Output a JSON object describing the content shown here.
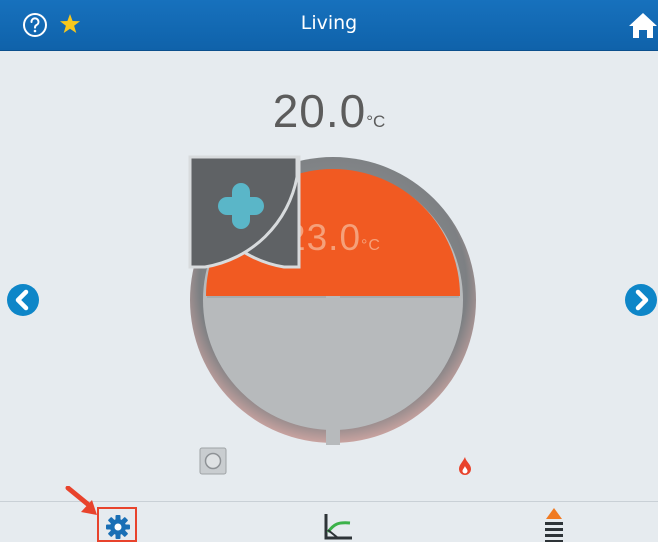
{
  "header": {
    "title": "Living",
    "icons": {
      "help": "help-icon",
      "favorite": "star-icon",
      "home": "home-icon"
    }
  },
  "current_temperature": {
    "value": "20.0",
    "unit": "°C"
  },
  "setpoint": {
    "value": "23.0",
    "unit": "°C"
  },
  "controls": {
    "decrease": "minus-icon",
    "increase": "plus-icon"
  },
  "navigation": {
    "previous": "chevron-left-icon",
    "next": "chevron-right-icon"
  },
  "status": {
    "mode": "mode-indicator-icon",
    "heating": "flame-icon"
  },
  "bottom_bar": {
    "settings": "gear-icon",
    "history": "chart-icon",
    "program": "program-icon"
  },
  "colors": {
    "header": "#0f62aa",
    "setpoint_fill": "#f15a22",
    "setpoint_text": "#f5a07a",
    "button_fill": "#5f6265",
    "button_symbol": "#5ab6c8",
    "nav_arrow": "#0e86c8",
    "flame": "#e8432c",
    "highlight": "#e8432c",
    "star": "#f7c81e"
  }
}
